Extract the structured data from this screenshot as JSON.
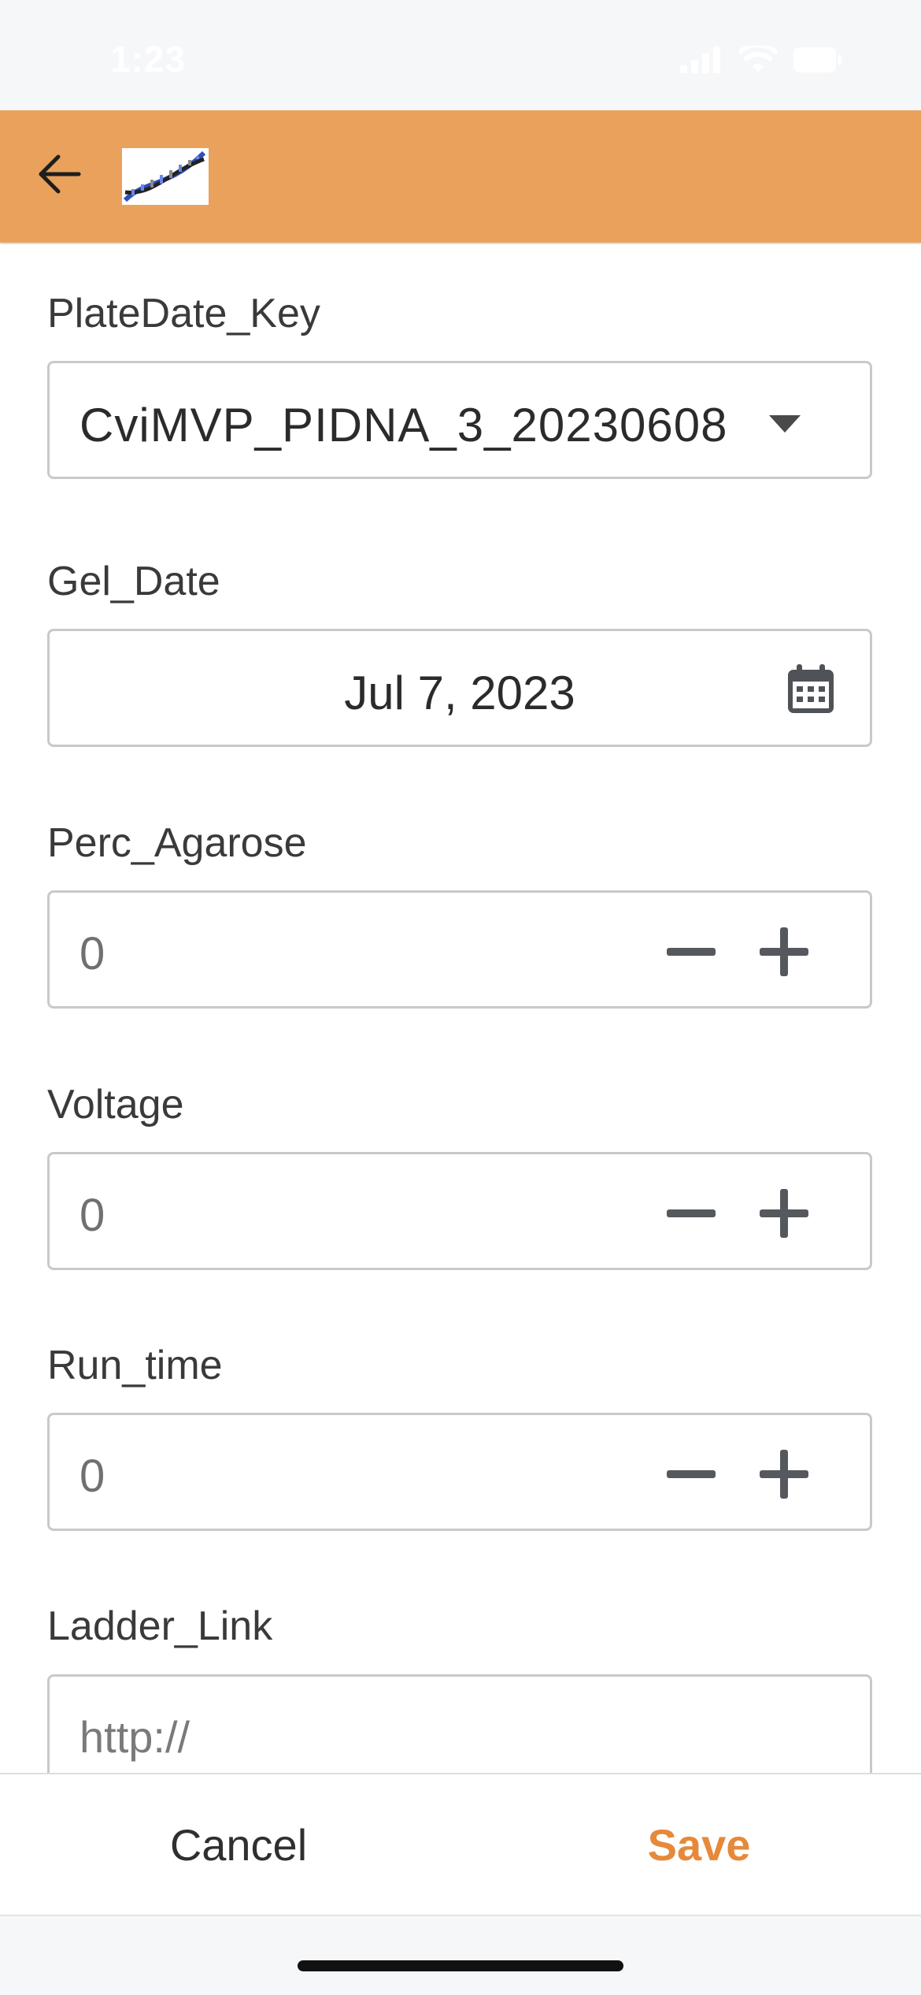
{
  "status_bar": {
    "time": "1:23"
  },
  "header": {
    "back_icon": "arrow-left-icon",
    "logo": "dna-helix-logo",
    "background_color": "#e9a15c"
  },
  "form": {
    "plate_date_key": {
      "label": "PlateDate_Key",
      "value": "CviMVP_PIDNA_3_20230608"
    },
    "gel_date": {
      "label": "Gel_Date",
      "value": "Jul 7, 2023"
    },
    "perc_agarose": {
      "label": "Perc_Agarose",
      "value": "0"
    },
    "voltage": {
      "label": "Voltage",
      "value": "0"
    },
    "run_time": {
      "label": "Run_time",
      "value": "0"
    },
    "ladder_link": {
      "label": "Ladder_Link",
      "placeholder": "http://"
    }
  },
  "actions": {
    "cancel_label": "Cancel",
    "save_label": "Save",
    "save_color": "#e6893a"
  }
}
